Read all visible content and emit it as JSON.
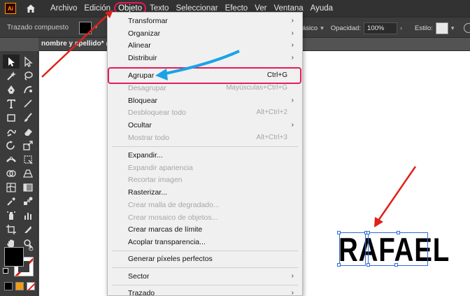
{
  "app": {
    "logo_text": "Ai"
  },
  "menubar": {
    "items": [
      "Archivo",
      "Edición",
      "Objeto",
      "Texto",
      "Seleccionar",
      "Efecto",
      "Ver",
      "Ventana",
      "Ayuda"
    ]
  },
  "controlbar": {
    "selection_label": "Trazado compuesto",
    "style_value_partial": "ásico",
    "opacity_label": "Opacidad:",
    "opacity_value": "100%",
    "style_label": "Estilo:"
  },
  "document": {
    "tab_title": "nombre y apellido* @"
  },
  "object_menu": {
    "items": [
      {
        "label": "Transformar",
        "submenu": true
      },
      {
        "label": "Organizar",
        "submenu": true
      },
      {
        "label": "Alinear",
        "submenu": true
      },
      {
        "label": "Distribuir",
        "submenu": true
      },
      {
        "label": "Agrupar",
        "shortcut": "Ctrl+G",
        "highlighted": true
      },
      {
        "label": "Desagrupar",
        "shortcut": "Mayúsculas+Ctrl+G",
        "disabled": true
      },
      {
        "label": "Bloquear",
        "submenu": true
      },
      {
        "label": "Desbloquear todo",
        "shortcut": "Alt+Ctrl+2",
        "disabled": true
      },
      {
        "label": "Ocultar",
        "submenu": true
      },
      {
        "label": "Mostrar todo",
        "shortcut": "Alt+Ctrl+3",
        "disabled": true
      },
      {
        "label": "Expandir..."
      },
      {
        "label": "Expandir apariencia",
        "disabled": true
      },
      {
        "label": "Recortar imagen",
        "disabled": true
      },
      {
        "label": "Rasterizar..."
      },
      {
        "label": "Crear malla de degradado...",
        "disabled": true
      },
      {
        "label": "Crear mosaico de objetos...",
        "disabled": true
      },
      {
        "label": "Crear marcas de límite"
      },
      {
        "label": "Acoplar transparencia..."
      },
      {
        "label": "Generar píxeles perfectos"
      },
      {
        "label": "Sector",
        "submenu": true
      },
      {
        "label": "Trazado",
        "submenu": true
      }
    ],
    "submenu_arrow": "›"
  },
  "canvas": {
    "artwork_text": "RAFAEL"
  },
  "colors": {
    "annotation_red": "#e0201a",
    "annotation_pink": "#e8195a",
    "annotation_blue": "#1aa3e8",
    "selection_blue": "#2e6bd8"
  },
  "icons": [
    "home-icon",
    "selection-tool-icon",
    "direct-selection-tool-icon",
    "magic-wand-icon",
    "lasso-icon",
    "pen-icon",
    "curvature-icon",
    "type-icon",
    "line-icon",
    "rectangle-icon",
    "paintbrush-icon",
    "shaper-icon",
    "eraser-icon",
    "rotate-icon",
    "scale-icon",
    "width-icon",
    "free-transform-icon",
    "shape-builder-icon",
    "perspective-icon",
    "mesh-icon",
    "gradient-icon",
    "eyedropper-icon",
    "blend-icon",
    "symbol-sprayer-icon",
    "graph-icon",
    "artboard-icon",
    "slice-icon",
    "hand-icon",
    "zoom-icon",
    "swap-colors-icon",
    "default-colors-icon",
    "chevron-down-icon"
  ]
}
